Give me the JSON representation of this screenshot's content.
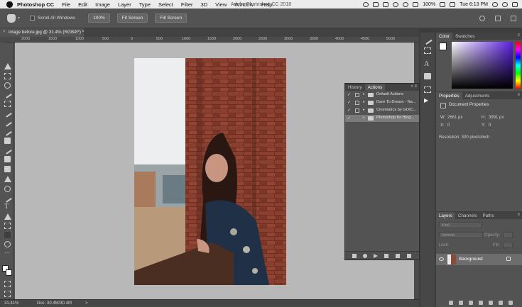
{
  "menubar": {
    "app": "Photoshop CC",
    "menus": [
      "File",
      "Edit",
      "Image",
      "Layer",
      "Type",
      "Select",
      "Filter",
      "3D",
      "View",
      "Window",
      "Help"
    ],
    "window_title": "Adobe Photoshop CC 2018",
    "battery": "100%",
    "clock": "Tue 6:13 PM"
  },
  "options_bar": {
    "scroll_all_windows": "Scroll All Windows",
    "zoom_100": "100%",
    "fit_screen": "Fit Screen",
    "fill_screen": "Fill Screen"
  },
  "document": {
    "tab_title": "image before.jpg @ 31.4% (RGB/8*) *",
    "ruler_labels": [
      "2000",
      "1500",
      "1000",
      "500",
      "0",
      "500",
      "1000",
      "1500",
      "2000",
      "2500",
      "3000",
      "3500",
      "4000",
      "4500",
      "5000"
    ]
  },
  "status": {
    "zoom": "31.41%",
    "doc": "Doc: 30.4M/30.4M",
    "arrow": ">"
  },
  "actions_panel": {
    "tabs": [
      "History",
      "Actions"
    ],
    "active_tab": "Actions",
    "items": [
      {
        "label": "Default Actions",
        "checked": true
      },
      {
        "label": "Dare To Dream - Na...",
        "checked": true
      },
      {
        "label": "Cinematics by GOIC...",
        "checked": true
      },
      {
        "label": "Photoshop for Blog...",
        "checked": true,
        "selected": true
      }
    ]
  },
  "color_panel": {
    "tabs": [
      "Color",
      "Swatches"
    ],
    "active_tab": "Color",
    "hue_color": "#5b1fe3"
  },
  "properties_panel": {
    "tabs": [
      "Properties",
      "Adjustments"
    ],
    "active_tab": "Properties",
    "section": "Document Properties",
    "w_label": "W:",
    "w_value": "2661 px",
    "h_label": "H:",
    "h_value": "3991 px",
    "x_label": "X:",
    "x_value": "0",
    "y_label": "Y:",
    "y_value": "0",
    "resolution": "Resolution: 300 pixels/inch"
  },
  "layers_panel": {
    "tabs": [
      "Layers",
      "Channels",
      "Paths"
    ],
    "active_tab": "Layers",
    "filter_placeholder": "Kind",
    "blend_mode": "Normal",
    "opacity_label": "Opacity:",
    "lock_label": "Lock:",
    "fill_label": "Fill:",
    "layer_name": "Background"
  }
}
